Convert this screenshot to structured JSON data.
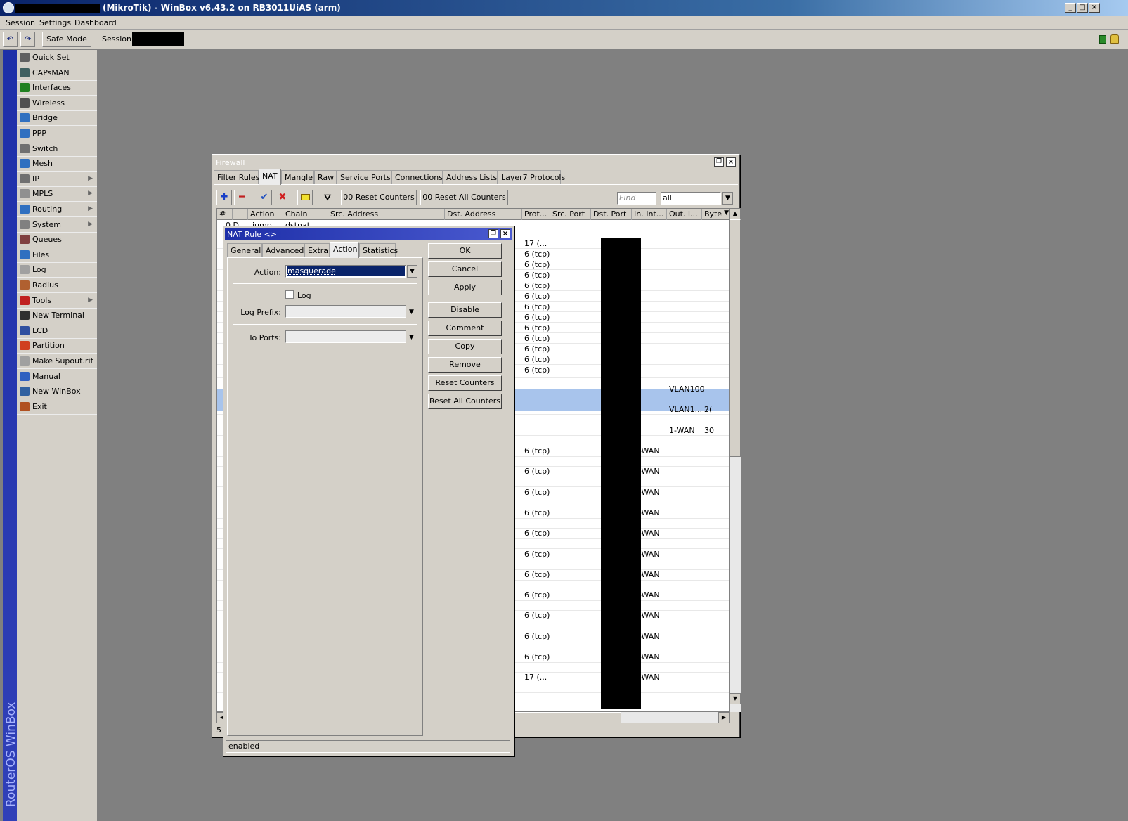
{
  "app": {
    "title": "(MikroTik) - WinBox v6.43.2 on RB3011UiAS (arm)"
  },
  "menu": [
    "Session",
    "Settings",
    "Dashboard"
  ],
  "toolbar": {
    "safe_mode": "Safe Mode",
    "session_label": "Session:"
  },
  "brand": "RouterOS WinBox",
  "sidebar": {
    "items": [
      {
        "label": "Quick Set",
        "icon": "quickset-icon",
        "color": "#606060",
        "sub": false
      },
      {
        "label": "CAPsMAN",
        "icon": "capsman-icon",
        "color": "#406060",
        "sub": false
      },
      {
        "label": "Interfaces",
        "icon": "interfaces-icon",
        "color": "#208020",
        "sub": false
      },
      {
        "label": "Wireless",
        "icon": "wireless-icon",
        "color": "#505050",
        "sub": false
      },
      {
        "label": "Bridge",
        "icon": "bridge-icon",
        "color": "#3070c0",
        "sub": false
      },
      {
        "label": "PPP",
        "icon": "ppp-icon",
        "color": "#3070c0",
        "sub": false
      },
      {
        "label": "Switch",
        "icon": "switch-icon",
        "color": "#707070",
        "sub": false
      },
      {
        "label": "Mesh",
        "icon": "mesh-icon",
        "color": "#3070c0",
        "sub": false
      },
      {
        "label": "IP",
        "icon": "ip-icon",
        "color": "#707070",
        "sub": true
      },
      {
        "label": "MPLS",
        "icon": "mpls-icon",
        "color": "#909090",
        "sub": true
      },
      {
        "label": "Routing",
        "icon": "routing-icon",
        "color": "#3070c0",
        "sub": true
      },
      {
        "label": "System",
        "icon": "system-icon",
        "color": "#808080",
        "sub": true
      },
      {
        "label": "Queues",
        "icon": "queues-icon",
        "color": "#804040",
        "sub": false
      },
      {
        "label": "Files",
        "icon": "files-icon",
        "color": "#3070c0",
        "sub": false
      },
      {
        "label": "Log",
        "icon": "log-icon",
        "color": "#a0a0a0",
        "sub": false
      },
      {
        "label": "Radius",
        "icon": "radius-icon",
        "color": "#b06030",
        "sub": false
      },
      {
        "label": "Tools",
        "icon": "tools-icon",
        "color": "#c02020",
        "sub": true
      },
      {
        "label": "New Terminal",
        "icon": "terminal-icon",
        "color": "#303030",
        "sub": false
      },
      {
        "label": "LCD",
        "icon": "lcd-icon",
        "color": "#3050a0",
        "sub": false
      },
      {
        "label": "Partition",
        "icon": "partition-icon",
        "color": "#d04020",
        "sub": false
      },
      {
        "label": "Make Supout.rif",
        "icon": "supout-icon",
        "color": "#a0a0a0",
        "sub": false
      },
      {
        "label": "Manual",
        "icon": "manual-icon",
        "color": "#3060c0",
        "sub": false
      },
      {
        "label": "New WinBox",
        "icon": "winbox-icon",
        "color": "#3060a0",
        "sub": false
      },
      {
        "label": "Exit",
        "icon": "exit-icon",
        "color": "#b05020",
        "sub": false
      }
    ]
  },
  "firewall": {
    "title": "Firewall",
    "tabs": [
      "Filter Rules",
      "NAT",
      "Mangle",
      "Raw",
      "Service Ports",
      "Connections",
      "Address Lists",
      "Layer7 Protocols"
    ],
    "selected_tab": "NAT",
    "reset_counters": "00 Reset Counters",
    "reset_all_counters": "00 Reset All Counters",
    "find_placeholder": "Find",
    "filter_value": "all",
    "columns": [
      "#",
      "",
      "Action",
      "Chain",
      "Src. Address",
      "Dst. Address",
      "Prot...",
      "Src. Port",
      "Dst. Port",
      "In. Int...",
      "Out. I...",
      "Byte"
    ],
    "partial_first_row": [
      "0 D",
      "jump",
      "dstnat"
    ],
    "footer_count": "5"
  },
  "proto_cells": [
    "17 (...",
    "6 (tcp)",
    "6 (tcp)",
    "6 (tcp)",
    "6 (tcp)",
    "6 (tcp)",
    "6 (tcp)",
    "6 (tcp)",
    "6 (tcp)",
    "6 (tcp)",
    "6 (tcp)",
    "6 (tcp)",
    "6 (tcp)"
  ],
  "mid_rows": [
    {
      "out": "VLAN100",
      "bytes": ""
    },
    {
      "out": "VLAN1...",
      "bytes": "2("
    },
    {
      "out": "1-WAN",
      "bytes": "30"
    }
  ],
  "lower_rows": [
    {
      "proto": "6 (tcp)",
      "inint": "1-WAN"
    },
    {
      "proto": "6 (tcp)",
      "inint": "1-WAN"
    },
    {
      "proto": "6 (tcp)",
      "inint": "1-WAN"
    },
    {
      "proto": "6 (tcp)",
      "inint": "1-WAN"
    },
    {
      "proto": "6 (tcp)",
      "inint": "1-WAN"
    },
    {
      "proto": "6 (tcp)",
      "inint": "1-WAN"
    },
    {
      "proto": "6 (tcp)",
      "inint": "1-WAN"
    },
    {
      "proto": "6 (tcp)",
      "inint": "1-WAN"
    },
    {
      "proto": "6 (tcp)",
      "inint": "1-WAN"
    },
    {
      "proto": "6 (tcp)",
      "inint": "1-WAN"
    },
    {
      "proto": "6 (tcp)",
      "inint": "1-WAN"
    },
    {
      "proto": "17 (...",
      "inint": "1-WAN"
    }
  ],
  "nat_rule": {
    "title": "NAT Rule <>",
    "tabs": [
      "General",
      "Advanced",
      "Extra",
      "Action",
      "Statistics"
    ],
    "selected_tab": "Action",
    "action_label": "Action:",
    "action_value": "masquerade",
    "log_label": "Log",
    "log_prefix_label": "Log Prefix:",
    "to_ports_label": "To Ports:",
    "buttons": [
      "OK",
      "Cancel",
      "Apply",
      "Disable",
      "Comment",
      "Copy",
      "Remove",
      "Reset Counters",
      "Reset All Counters"
    ],
    "status": "enabled"
  },
  "colors": {
    "titlebar": "#0a246a",
    "selected_row": "#a8c4ec",
    "nat_title": "#2d3cb4",
    "sidebar_brand": "#1e2fa8"
  }
}
